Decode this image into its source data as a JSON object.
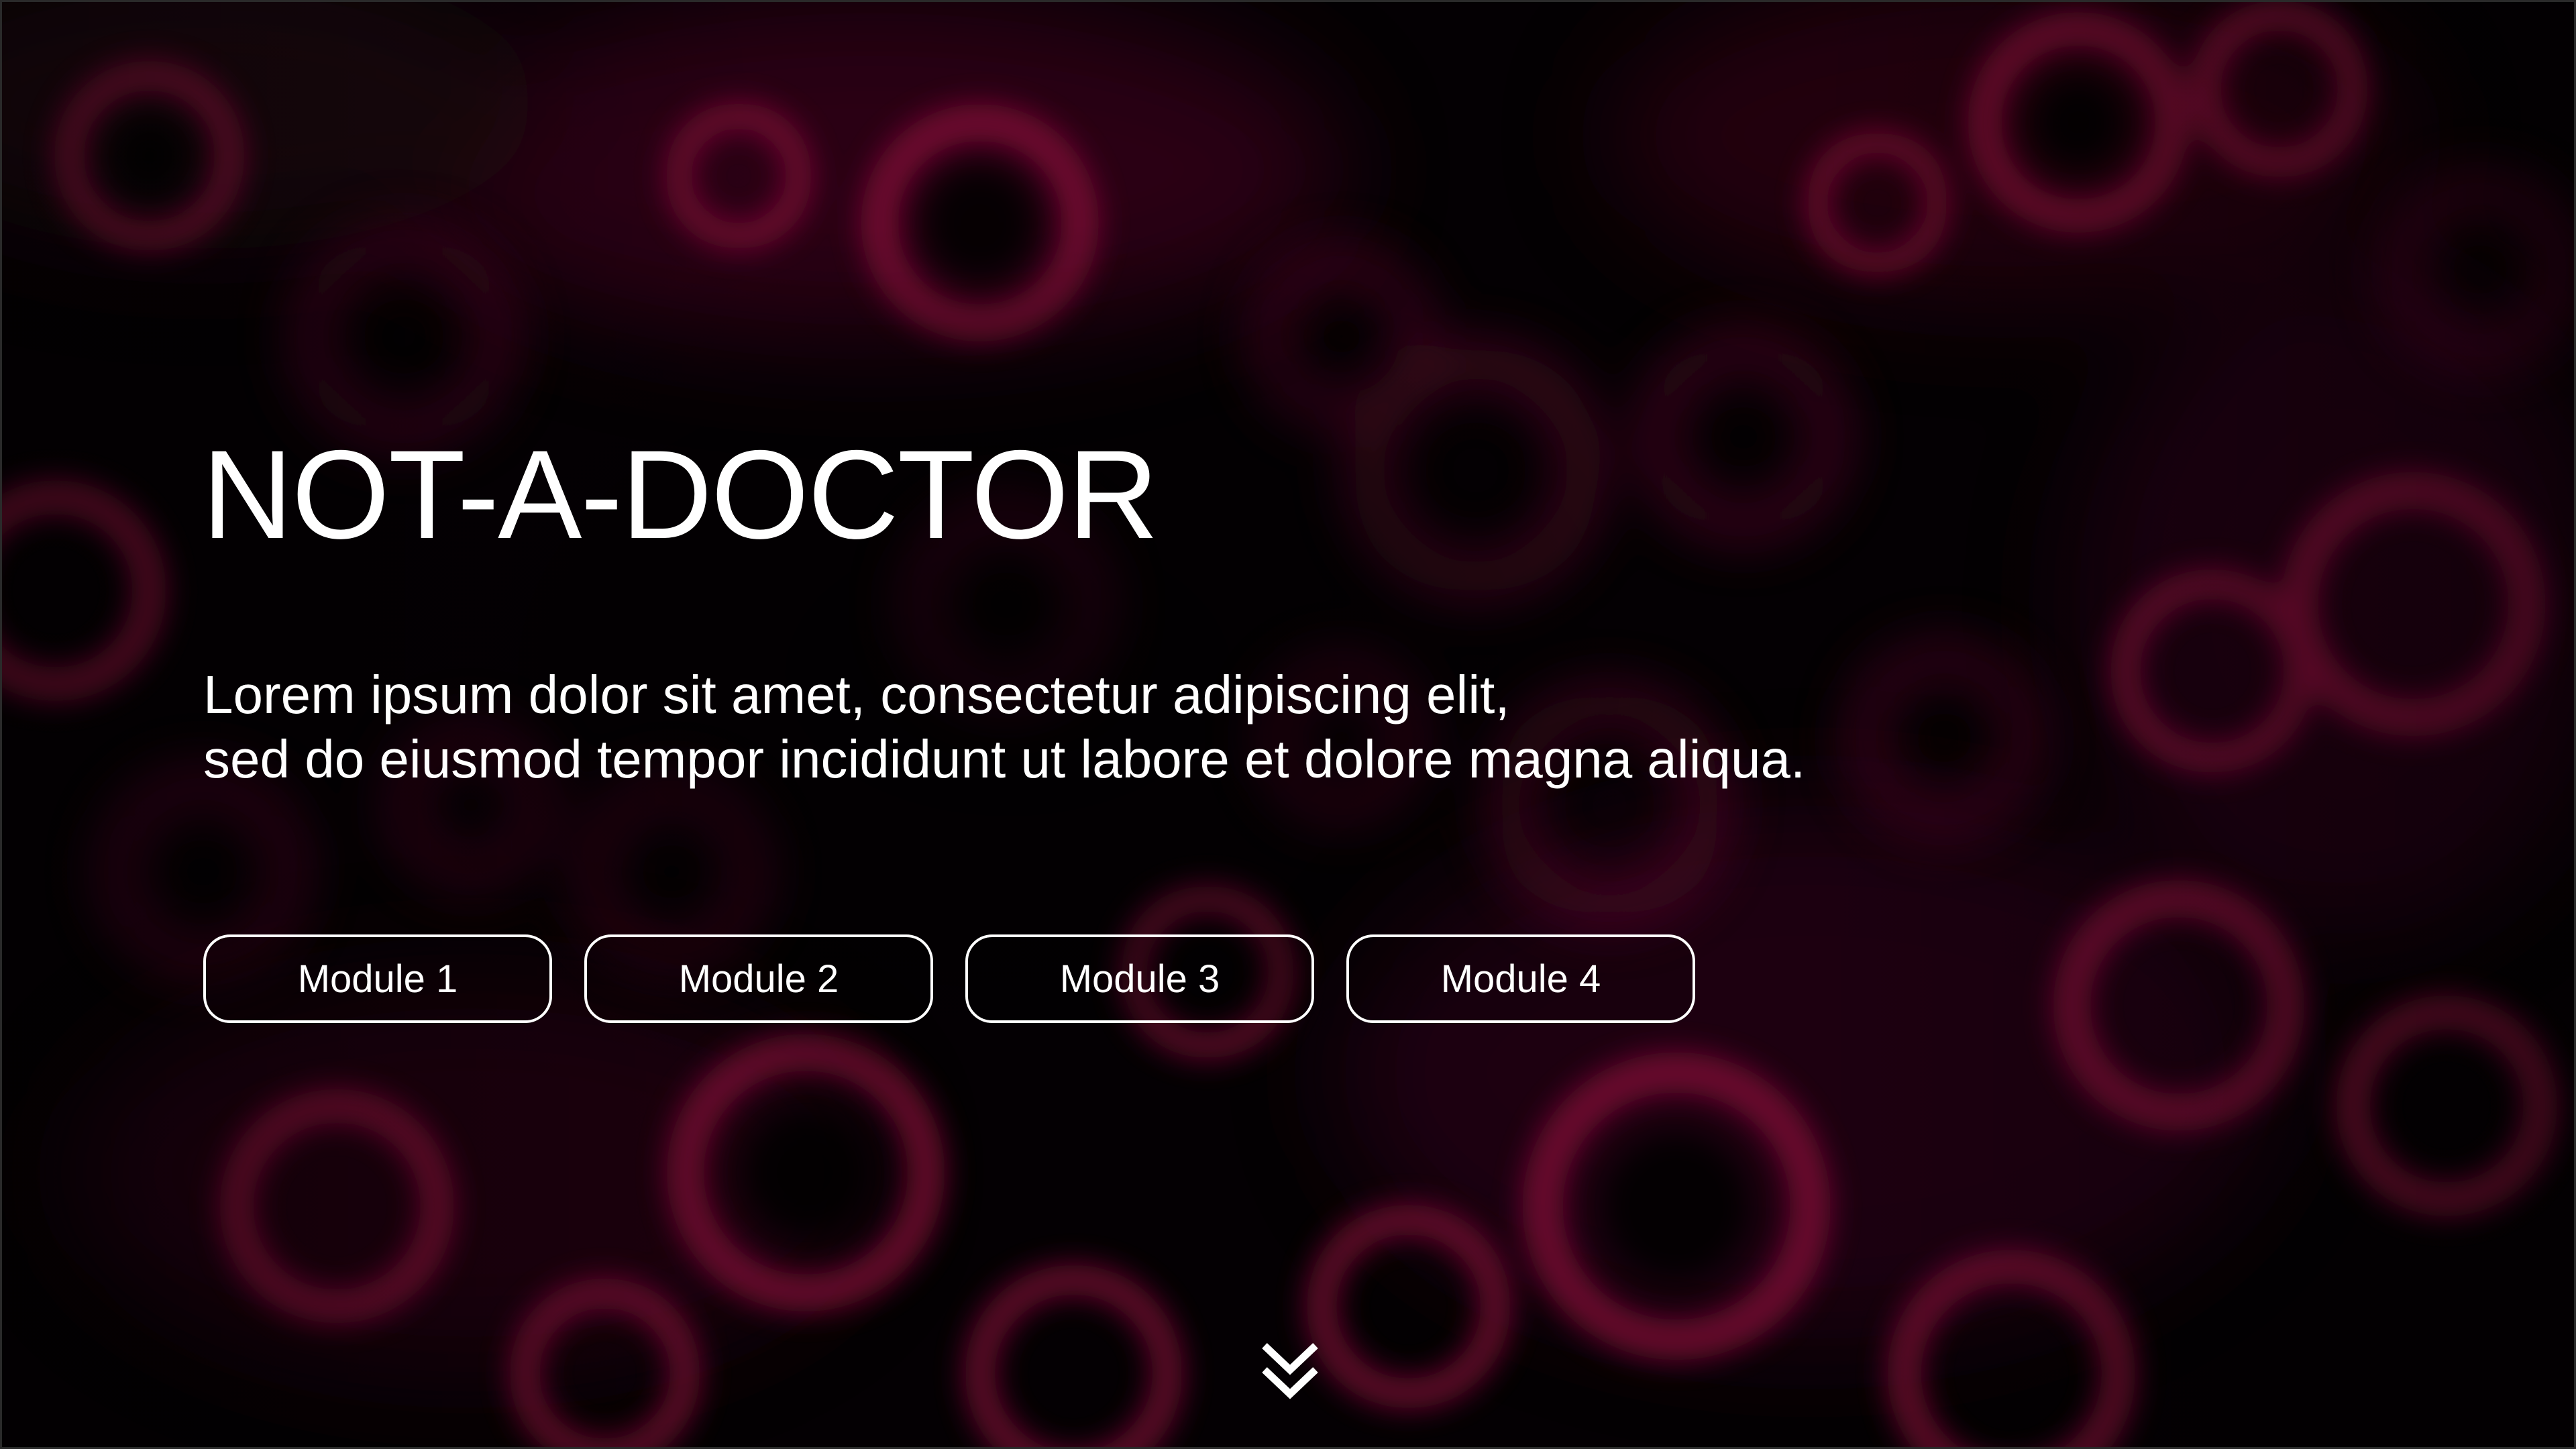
{
  "hero": {
    "title": "NOT-A-DOCTOR",
    "description_lines": [
      "Lorem ipsum dolor sit amet, consectetur adipiscing elit,",
      "sed do eiusmod tempor incididunt ut labore et dolore magna aliqua."
    ]
  },
  "modules": [
    {
      "label": "Module 1"
    },
    {
      "label": "Module 2"
    },
    {
      "label": "Module 3"
    },
    {
      "label": "Module 4"
    }
  ],
  "scroll": {
    "icon": "double-chevron-down-icon"
  },
  "colors": {
    "accent": "#c2134f",
    "background": "#050004",
    "text": "#ffffff"
  }
}
